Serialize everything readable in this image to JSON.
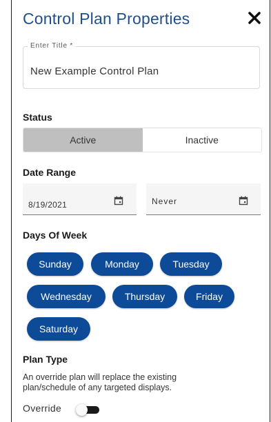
{
  "dialog": {
    "title": "Control Plan Properties",
    "close_icon": "close-icon"
  },
  "title_field": {
    "label": "Enter Title *",
    "value": "New Example Control Plan"
  },
  "status": {
    "label": "Status",
    "options": [
      "Active",
      "Inactive"
    ],
    "selected": "Active"
  },
  "date_range": {
    "label": "Date Range",
    "start": "8/19/2021",
    "end": "Never",
    "icon": "calendar-icon"
  },
  "days_of_week": {
    "label": "Days Of Week",
    "days": [
      "Sunday",
      "Monday",
      "Tuesday",
      "Wednesday",
      "Thursday",
      "Friday",
      "Saturday"
    ]
  },
  "plan_type": {
    "label": "Plan Type",
    "description": "An override plan will replace the existing plan/schedule of any targeted displays.",
    "override_label": "Override",
    "override_enabled": false
  },
  "colors": {
    "title": "#1f4f8b",
    "day_pill": "#0d4a97",
    "active_segment": "#bfbfbf"
  }
}
